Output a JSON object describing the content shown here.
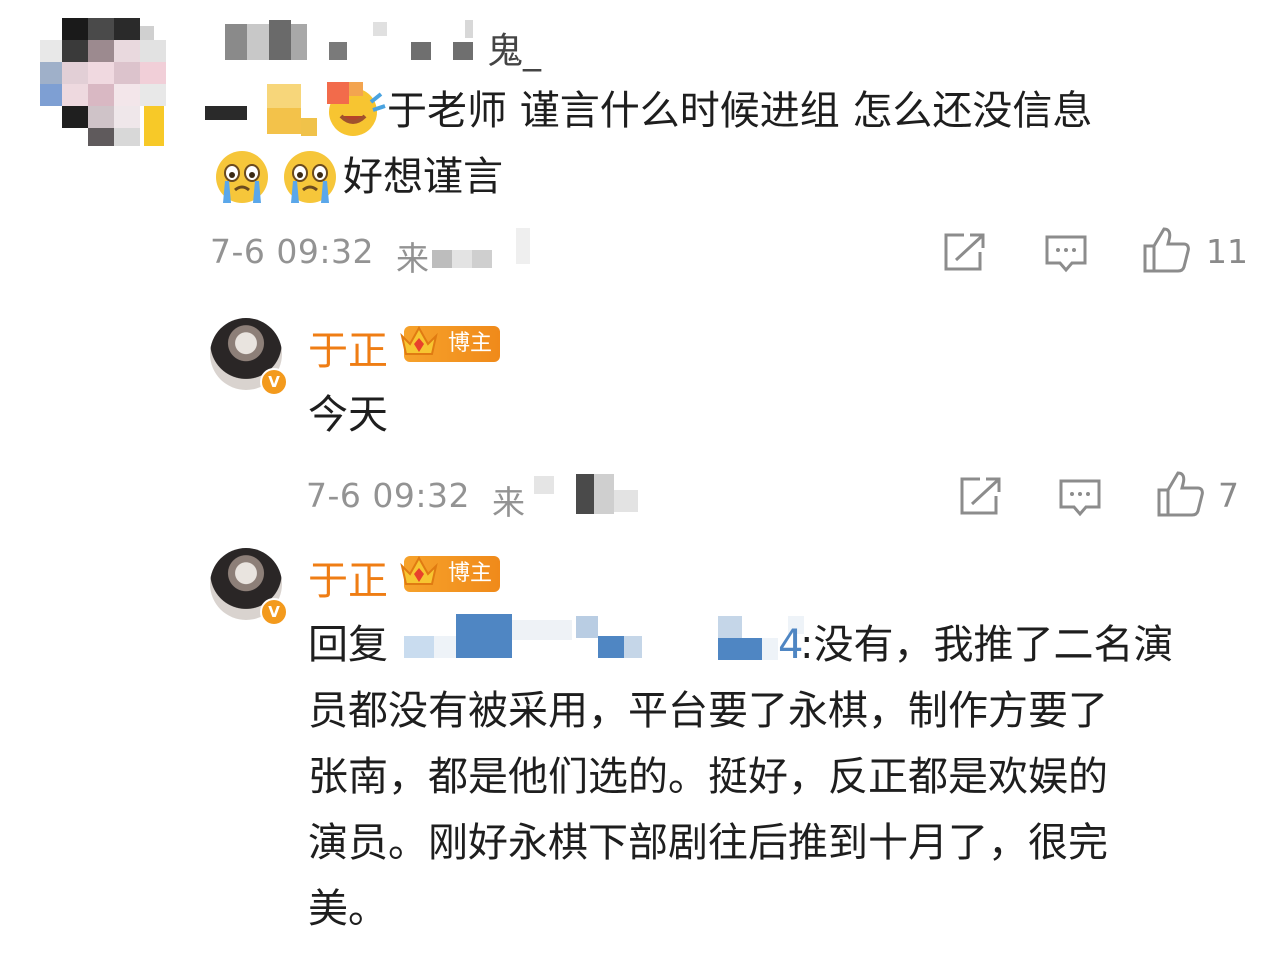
{
  "comment": {
    "text_line1": "于老师 谨言什么时候进组 怎么还没信息",
    "text_line2": "好想谨言",
    "username_visible_suffix": "鬼_",
    "timestamp": "7-6 09:32",
    "source_prefix": "来",
    "like_count": "11"
  },
  "reply1": {
    "author": "于正",
    "badge": "博主",
    "text": "今天",
    "timestamp": "7-6 09:32",
    "source_prefix": "来",
    "like_count": "7"
  },
  "reply2": {
    "author": "于正",
    "badge": "博主",
    "reply_prefix": "回复",
    "mention_tail": "4",
    "lines": [
      ":没有，我推了二名演",
      "员都没有被采用，平台要了永棋，制作方要了",
      "张南，都是他们选的。挺好，反正都是欢娱的",
      "演员。刚好永棋下部剧往后推到十月了，很完",
      "美。"
    ]
  },
  "icons": {
    "share": "share-icon",
    "comment": "comment-icon",
    "like": "thumbs-up-icon",
    "emoji": "crying-face-emoji",
    "crown": "crown-icon",
    "verified": "verified-badge-icon"
  },
  "colors": {
    "accent_orange": "#ef7d14",
    "meta_gray": "#939393",
    "text": "#1e1e1e"
  }
}
